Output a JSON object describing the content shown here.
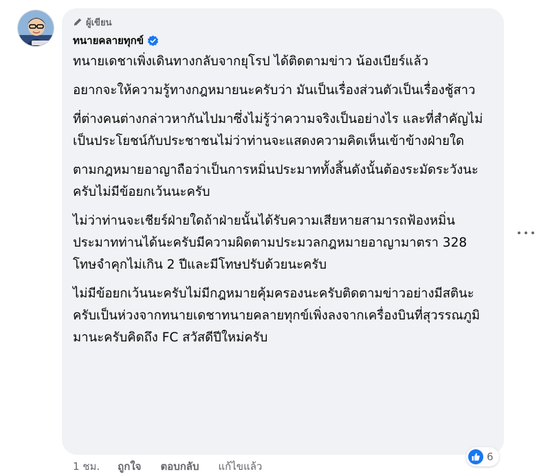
{
  "comment": {
    "badge": "ผู้เขียน",
    "author": "ทนายคลายทุกข์",
    "paragraphs": [
      "ทนายเดชาเพิ่งเดินทางกลับจากยุโรป ได้ติดตามข่าว น้องเบียร์แล้ว",
      "อยากจะให้ความรู้ทางกฎหมายนะครับว่า มันเป็นเรื่องส่วนตัวเป็นเรื่องชู้สาว",
      "ที่ต่างคนต่างกล่าวหากันไปมาซึ่งไม่รู้ว่าความจริงเป็นอย่างไร และที่สำคัญไม่เป็นประโยชน์กับประชาชนไม่ว่าท่านจะแสดงความคิดเห็นเข้าข้างฝ่ายใด",
      "ตามกฎหมายอาญาถือว่าเป็นการหมิ่นประมาททั้งสิ้นดังนั้นต้องระมัดระวังนะครับไม่มีข้อยกเว้นนะครับ",
      "ไม่ว่าท่านจะเชียร์ฝ่ายใดถ้าฝ่ายนั้นได้รับความเสียหายสามารถฟ้องหมิ่นประมาทท่านได้นะครับมีความผิดตามประมวลกฎหมายอาญามาตรา 328 โทษจำคุกไม่เกิน 2 ปีและมีโทษปรับด้วยนะครับ",
      "ไม่มีข้อยกเว้นนะครับไม่มีกฎหมายคุ้มครองนะครับติดตามข่าวอย่างมีสตินะครับเป็นห่วงจากทนายเดชาทนายคลายทุกข์เพิ่งลงจากเครื่องบินที่สุวรรณภูมิมานะครับคิดถึง FC สวัสดีปีใหม่ครับ"
    ],
    "reactions": {
      "icon": "like-icon",
      "count": "6"
    },
    "actions": {
      "time": "1 ชม.",
      "like": "ถูกใจ",
      "reply": "ตอบกลับ",
      "edited": "แก้ไขแล้ว"
    }
  },
  "colors": {
    "bubble": "#f0f2f5",
    "text": "#050505",
    "secondary": "#65676b",
    "verified": "#1877f2",
    "like": "#1877f2"
  }
}
